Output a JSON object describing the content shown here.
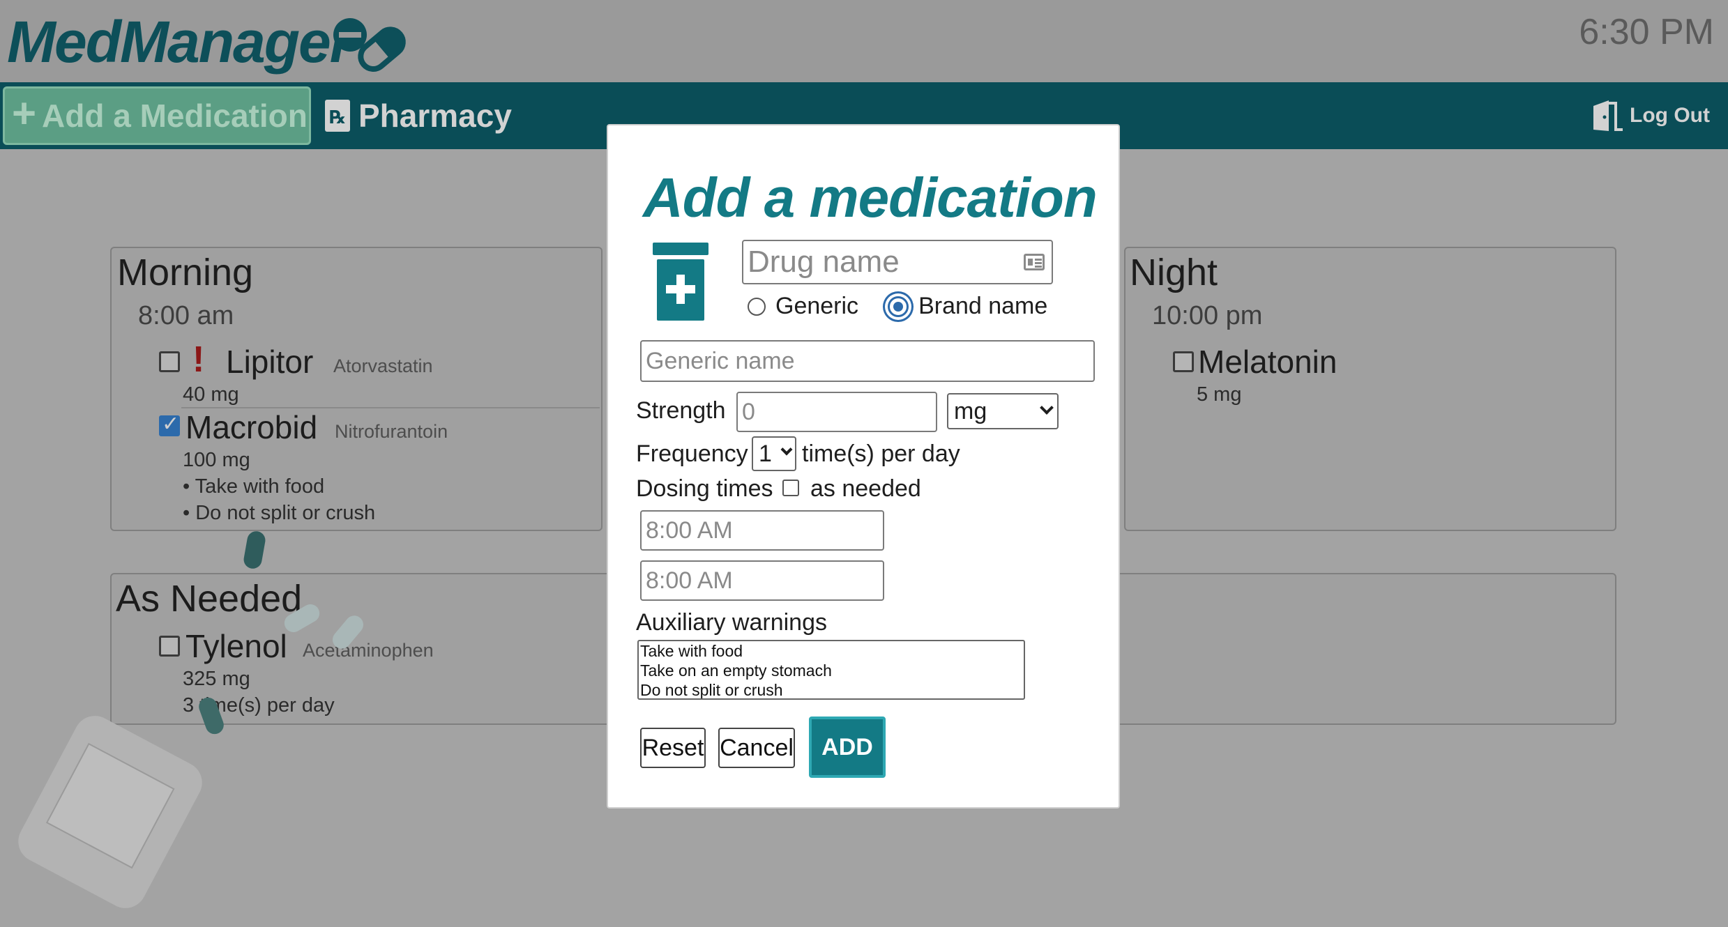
{
  "app": {
    "name": "MedManager",
    "clock": "6:30 PM"
  },
  "nav": {
    "add_label": "Add a Medication",
    "pharmacy_label": "Pharmacy",
    "rx_symbol": "℞",
    "logout_label": "Log Out"
  },
  "schedule": {
    "morning": {
      "title": "Morning",
      "time": "8:00 am",
      "meds": [
        {
          "name": "Lipitor",
          "generic": "Atorvastatin",
          "strength": "40 mg",
          "checked": false,
          "alert": "!"
        },
        {
          "name": "Macrobid",
          "generic": "Nitrofurantoin",
          "strength": "100 mg",
          "checked": true,
          "notes": [
            "• Take with food",
            "• Do not split or crush"
          ]
        }
      ]
    },
    "night": {
      "title": "Night",
      "time": "10:00 pm",
      "meds": [
        {
          "name": "Melatonin",
          "strength": "5 mg",
          "checked": false
        }
      ]
    },
    "as_needed": {
      "title": "As Needed",
      "meds": [
        {
          "name": "Tylenol",
          "generic": "Acetaminophen",
          "strength": "325 mg",
          "frequency": "3 time(s) per day",
          "checked": false
        }
      ]
    }
  },
  "modal": {
    "title": "Add a medication",
    "drug_name_placeholder": "Drug name",
    "radio_generic": "Generic",
    "radio_brand": "Brand name",
    "radio_selected": "Brand name",
    "generic_name_placeholder": "Generic name",
    "strength_label": "Strength",
    "strength_placeholder": "0",
    "unit_selected": "mg",
    "frequency_label": "Frequency",
    "frequency_selected": "1",
    "frequency_suffix": "time(s) per day",
    "dosing_times_label": "Dosing times",
    "as_needed_label": "as needed",
    "dosing_time_1": "8:00 AM",
    "dosing_time_2": "8:00 AM",
    "aux_warnings_label": "Auxiliary warnings",
    "aux_warnings": [
      "Take with food",
      "Take on an empty stomach",
      "Do not split or crush"
    ],
    "reset_label": "Reset",
    "cancel_label": "Cancel",
    "add_label": "ADD"
  },
  "colors": {
    "brand": "#137a85",
    "navbar": "#0a4d57",
    "selected": "#2c6aab",
    "alert": "#c01f1f"
  },
  "icons": [
    "pill-logo-icon",
    "plus-icon",
    "rx-icon",
    "logout-door-icon",
    "medicine-bottle-icon",
    "id-card-icon",
    "chevron-down-icon"
  ]
}
